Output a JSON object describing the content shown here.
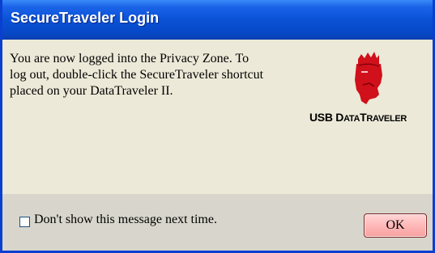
{
  "window": {
    "title": "SecureTraveler Login"
  },
  "message": {
    "line1": "You are now logged into the Privacy Zone. To",
    "line2": "log out, double-click the SecureTraveler shortcut",
    "line3": "placed on your DataTraveler II."
  },
  "logo": {
    "prefix": "USB ",
    "brand_d": "D",
    "brand_ata": "ATA",
    "brand_t": "T",
    "brand_raveler": "RAVELER",
    "icon": "kingston-head-icon"
  },
  "footer": {
    "checkbox_label": "Don't show this message next time.",
    "checkbox_checked": false,
    "ok_label": "OK"
  },
  "colors": {
    "titlebar": "#0a52d6",
    "background": "#ece9d8",
    "footer": "#d8d6cc",
    "ok_button": "#ffb8b8",
    "logo_red": "#d0101a"
  }
}
